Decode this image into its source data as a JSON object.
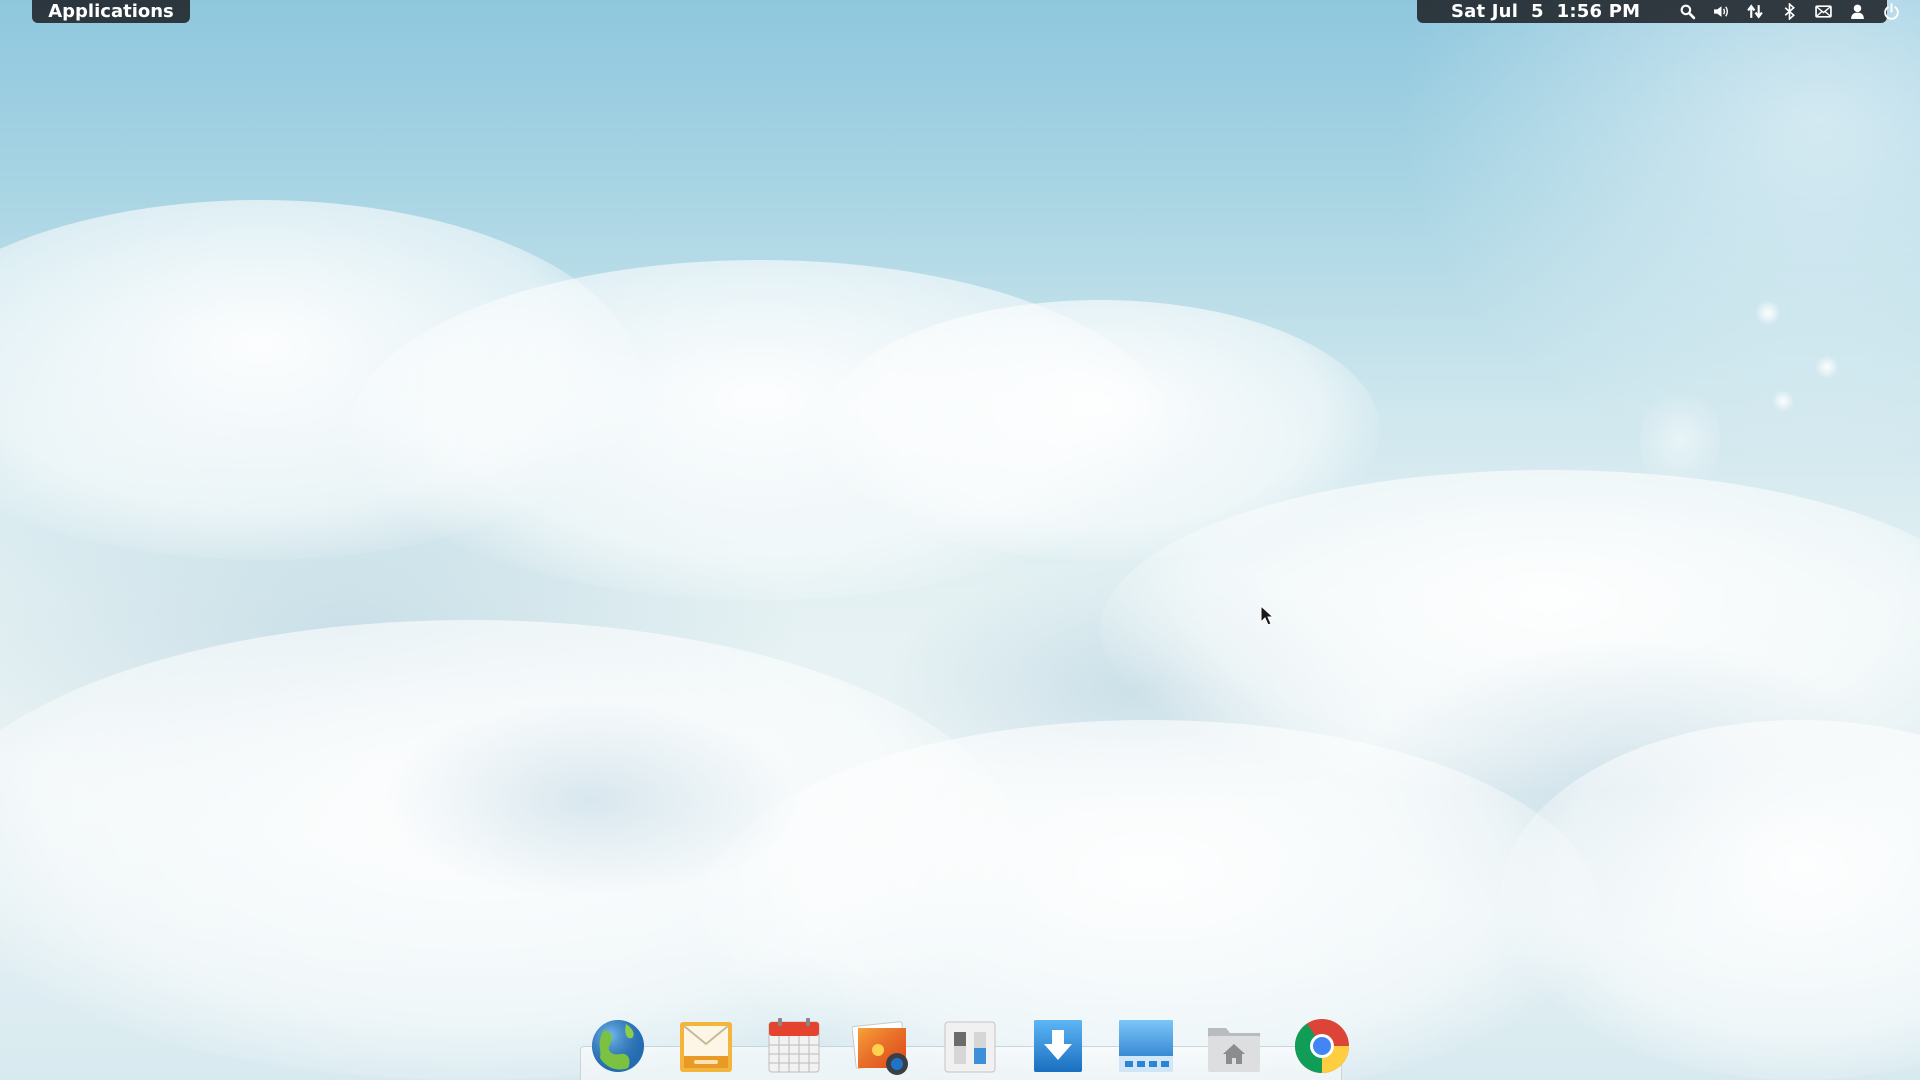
{
  "top_panel": {
    "applications_label": "Applications",
    "clock": "Sat Jul  5  1:56 PM",
    "indicators": [
      {
        "icon": "search-icon"
      },
      {
        "icon": "volume-icon"
      },
      {
        "icon": "network-icon"
      },
      {
        "icon": "bluetooth-icon"
      },
      {
        "icon": "messages-icon"
      },
      {
        "icon": "user-icon"
      },
      {
        "icon": "power-icon"
      }
    ]
  },
  "dock": {
    "items": [
      {
        "name": "web-browser",
        "icon": "globe-icon"
      },
      {
        "name": "mail",
        "icon": "mail-icon"
      },
      {
        "name": "calendar",
        "icon": "calendar-icon"
      },
      {
        "name": "photos",
        "icon": "photo-camera-icon"
      },
      {
        "name": "system-settings",
        "icon": "toggles-icon"
      },
      {
        "name": "app-center",
        "icon": "download-icon"
      },
      {
        "name": "multitasking",
        "icon": "workspace-icon"
      },
      {
        "name": "files",
        "icon": "home-folder-icon"
      },
      {
        "name": "google-chrome",
        "icon": "chrome-icon",
        "running": true
      }
    ]
  },
  "colors": {
    "panel_bg": "#1e2228",
    "panel_text": "#ffffff",
    "sky_top": "#8fc7de",
    "sky_bottom": "#eaf3f5",
    "running_indicator": "#3b8fd6"
  }
}
